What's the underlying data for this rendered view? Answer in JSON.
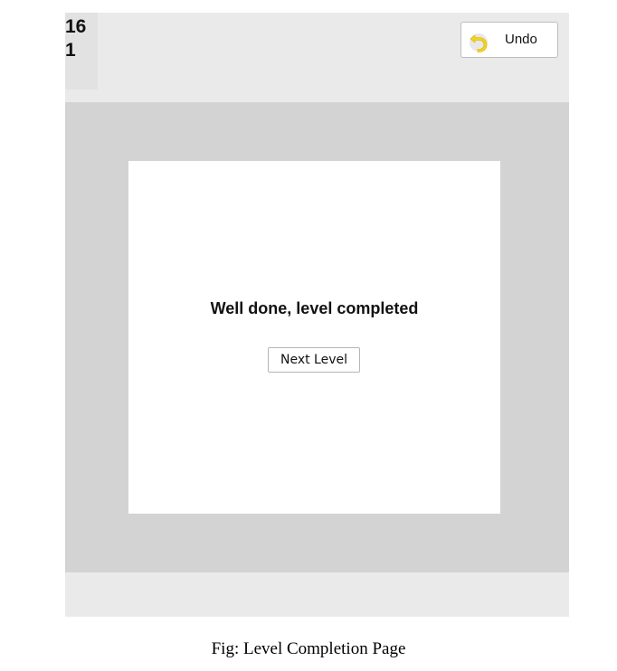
{
  "header": {
    "level_number": "16",
    "moves_count": "1",
    "undo_label": "Undo",
    "undo_icon": "undo-arrow-icon"
  },
  "dialog": {
    "message": "Well done, level completed",
    "next_level_label": "Next Level"
  },
  "caption": "Fig: Level Completion Page",
  "colors": {
    "app_background": "#eaeaea",
    "board_background": "#d3d3d3",
    "dialog_background": "#ffffff",
    "undo_icon_color": "#f5d21b"
  }
}
